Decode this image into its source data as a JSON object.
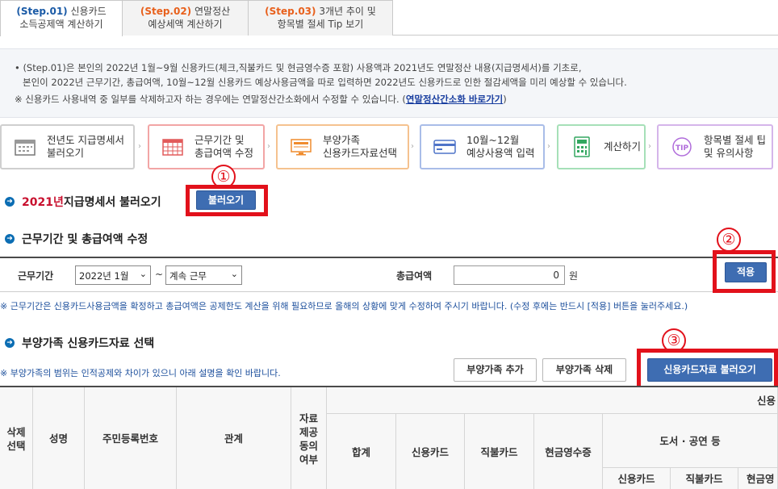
{
  "tabs": [
    {
      "step": "(Step.01)",
      "line1": "신용카드",
      "line2": "소득공제액 계산하기"
    },
    {
      "step": "(Step.02)",
      "line1": "연말정산",
      "line2": "예상세액 계산하기"
    },
    {
      "step": "(Step.03)",
      "line1": "3개년 추이 및",
      "line2": "항목별 절세 Tip 보기"
    }
  ],
  "notice": {
    "line1": "• (Step.01)은 본인의 2022년 1월~9월 신용카드(체크,직불카드 및 현금영수증 포함) 사용액과 2021년도 연말정산 내용(지급명세서)를 기초로,",
    "line2": "본인이 2022년 근무기간, 총급여액, 10월~12월 신용카드 예상사용금액을 따로 입력하면 2022년도 신용카드로 인한 절감세액을 미리 예상할 수 있습니다.",
    "line3": "※ 신용카드 사용내역 중 일부를 삭제하고자 하는 경우에는 연말정산간소화에서 수정할 수 있습니다. (",
    "link": "연말정산간소화 바로가기",
    "line3_end": ")"
  },
  "steps": [
    {
      "label": "전년도 지급명세서\n불러오기",
      "icon": "calendar-icon",
      "color": "#c8c8c8"
    },
    {
      "label": "근무기간 및\n총급여액 수정",
      "icon": "calendar-grid-icon",
      "color": "#f2a5a5"
    },
    {
      "label": "부양가족\n신용카드자료선택",
      "icon": "monitor-icon",
      "color": "#f5c28f"
    },
    {
      "label": "10월~12월\n예상사용액 입력",
      "icon": "card-icon",
      "color": "#a9bde8"
    },
    {
      "label": "계산하기",
      "icon": "calculator-icon",
      "color": "#a6e0b8"
    },
    {
      "label": "항목별 절세 팁\n및 유의사항",
      "icon": "tip-icon",
      "color": "#d5b5ea"
    }
  ],
  "markers": [
    "①",
    "②",
    "③"
  ],
  "sec1": {
    "year": "2021년",
    "title": " 지급명세서 불러오기",
    "button": "불러오기"
  },
  "sec2": {
    "title": "근무기간 및 총급여액 수정",
    "period_label": "근무기간",
    "start_select": "2022년 1월",
    "tilde": "~",
    "end_select": "계속 근무",
    "total_label": "총급여액",
    "total_value": "0",
    "unit": "원",
    "apply": "적용",
    "note": "※ 근무기간은 신용카드사용금액을 확정하고 총급여액은 공제한도 계산을 위해 필요하므로 올해의 상황에 맞게 수정하여 주시기 바랍니다. (수정 후에는 반드시 [적용] 버튼을 눌러주세요.)"
  },
  "sec3": {
    "title": "부양가족 신용카드자료 선택",
    "note": "※ 부양가족의 범위는 인적공제와 차이가 있으니 아래 설명을 확인 바랍니다.",
    "add": "부양가족 추가",
    "delete": "부양가족 삭제",
    "load": "신용카드자료 불러오기"
  },
  "table": {
    "delete_select": "삭제\n선택",
    "name": "성명",
    "rrn": "주민등록번호",
    "relation": "관계",
    "provide": "자료\n제공\n동의\n여부",
    "group_top": "신용",
    "total": "합계",
    "credit": "신용카드",
    "debit": "직불카드",
    "cash": "현금영수증",
    "books": "도서 · 공연 등",
    "sub_credit": "신용카드",
    "sub_debit": "직불카드",
    "sub_cash": "현금영"
  }
}
